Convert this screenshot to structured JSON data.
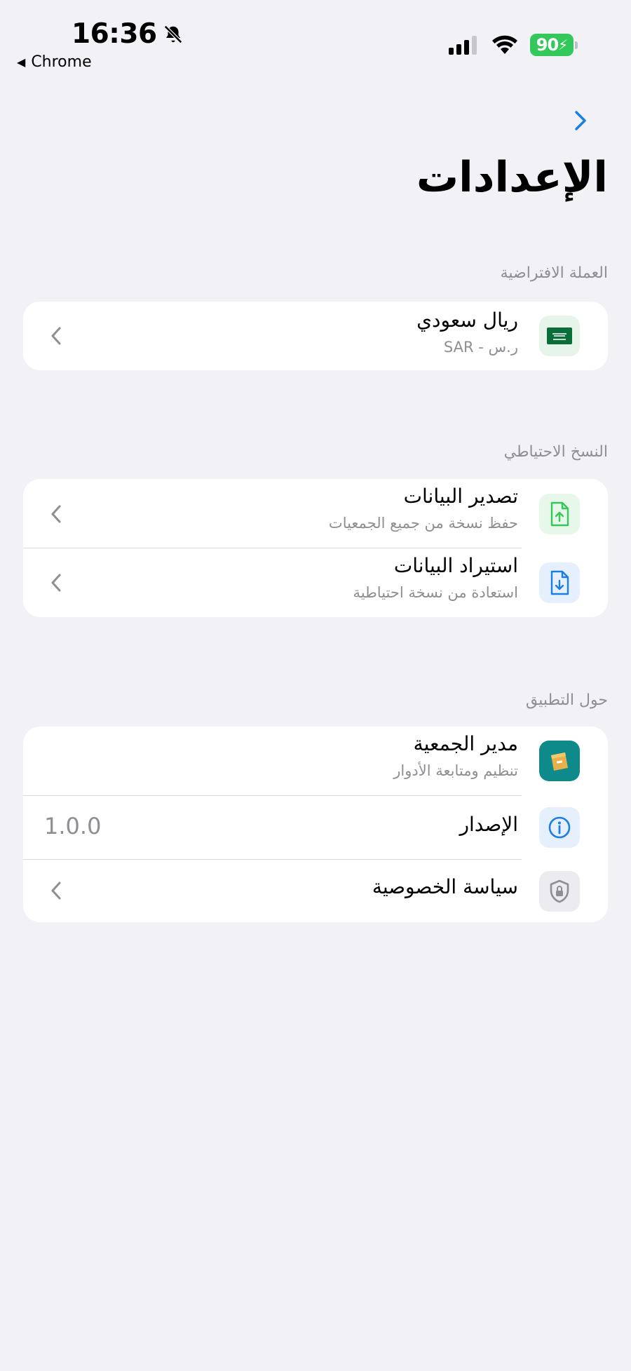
{
  "status_bar": {
    "time": "16:36",
    "back_app": "Chrome",
    "battery": "90"
  },
  "nav": {
    "title": "الإعدادات"
  },
  "sections": {
    "currency": {
      "label": "العملة الافتراضية",
      "item": {
        "title": "ريال سعودي",
        "subtitle": "ر.س - SAR",
        "icon": "saudi-flag-icon"
      }
    },
    "backup": {
      "label": "النسخ الاحتياطي",
      "items": [
        {
          "title": "تصدير البيانات",
          "subtitle": "حفظ نسخة من جميع الجمعيات",
          "icon": "file-export-icon",
          "color": "#34c759"
        },
        {
          "title": "استيراد البيانات",
          "subtitle": "استعادة من نسخة احتياطية",
          "icon": "file-import-icon",
          "color": "#1a7ee6"
        }
      ]
    },
    "about": {
      "label": "حول التطبيق",
      "app": {
        "title": "مدير الجمعية",
        "subtitle": "تنظيم ومتابعة الأدوار",
        "icon": "app-logo-icon"
      },
      "version": {
        "title": "الإصدار",
        "value": "1.0.0",
        "icon": "info-icon"
      },
      "privacy": {
        "title": "سياسة الخصوصية",
        "icon": "shield-lock-icon"
      }
    }
  },
  "colors": {
    "accent": "#1a7ee6",
    "background": "#f1f1f6",
    "secondary_text": "#8e8e93",
    "battery": "#34c759"
  }
}
